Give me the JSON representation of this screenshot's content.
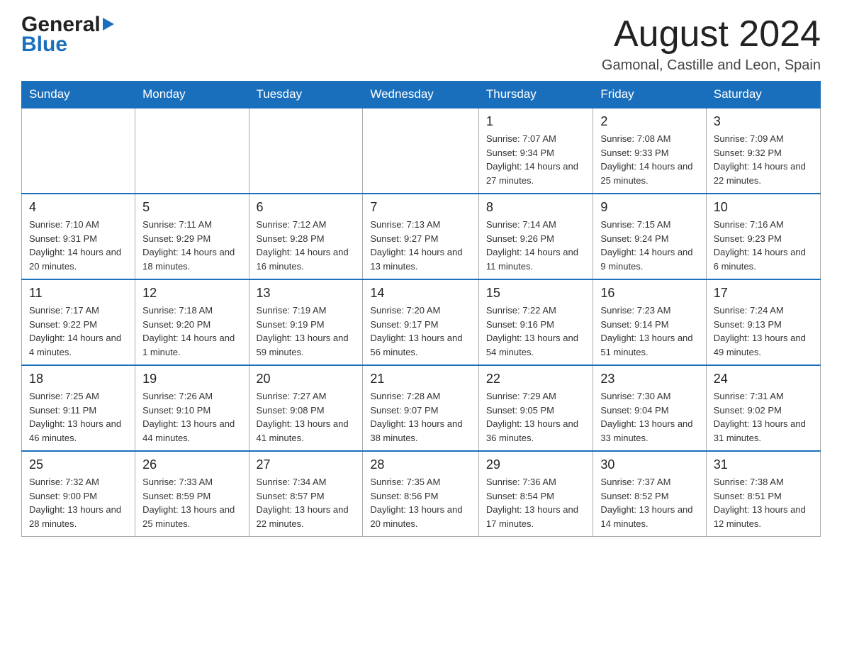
{
  "header": {
    "logo_general": "General",
    "logo_blue": "Blue",
    "month_title": "August 2024",
    "subtitle": "Gamonal, Castille and Leon, Spain"
  },
  "calendar": {
    "days_of_week": [
      "Sunday",
      "Monday",
      "Tuesday",
      "Wednesday",
      "Thursday",
      "Friday",
      "Saturday"
    ],
    "weeks": [
      [
        {
          "day": "",
          "info": ""
        },
        {
          "day": "",
          "info": ""
        },
        {
          "day": "",
          "info": ""
        },
        {
          "day": "",
          "info": ""
        },
        {
          "day": "1",
          "info": "Sunrise: 7:07 AM\nSunset: 9:34 PM\nDaylight: 14 hours and 27 minutes."
        },
        {
          "day": "2",
          "info": "Sunrise: 7:08 AM\nSunset: 9:33 PM\nDaylight: 14 hours and 25 minutes."
        },
        {
          "day": "3",
          "info": "Sunrise: 7:09 AM\nSunset: 9:32 PM\nDaylight: 14 hours and 22 minutes."
        }
      ],
      [
        {
          "day": "4",
          "info": "Sunrise: 7:10 AM\nSunset: 9:31 PM\nDaylight: 14 hours and 20 minutes."
        },
        {
          "day": "5",
          "info": "Sunrise: 7:11 AM\nSunset: 9:29 PM\nDaylight: 14 hours and 18 minutes."
        },
        {
          "day": "6",
          "info": "Sunrise: 7:12 AM\nSunset: 9:28 PM\nDaylight: 14 hours and 16 minutes."
        },
        {
          "day": "7",
          "info": "Sunrise: 7:13 AM\nSunset: 9:27 PM\nDaylight: 14 hours and 13 minutes."
        },
        {
          "day": "8",
          "info": "Sunrise: 7:14 AM\nSunset: 9:26 PM\nDaylight: 14 hours and 11 minutes."
        },
        {
          "day": "9",
          "info": "Sunrise: 7:15 AM\nSunset: 9:24 PM\nDaylight: 14 hours and 9 minutes."
        },
        {
          "day": "10",
          "info": "Sunrise: 7:16 AM\nSunset: 9:23 PM\nDaylight: 14 hours and 6 minutes."
        }
      ],
      [
        {
          "day": "11",
          "info": "Sunrise: 7:17 AM\nSunset: 9:22 PM\nDaylight: 14 hours and 4 minutes."
        },
        {
          "day": "12",
          "info": "Sunrise: 7:18 AM\nSunset: 9:20 PM\nDaylight: 14 hours and 1 minute."
        },
        {
          "day": "13",
          "info": "Sunrise: 7:19 AM\nSunset: 9:19 PM\nDaylight: 13 hours and 59 minutes."
        },
        {
          "day": "14",
          "info": "Sunrise: 7:20 AM\nSunset: 9:17 PM\nDaylight: 13 hours and 56 minutes."
        },
        {
          "day": "15",
          "info": "Sunrise: 7:22 AM\nSunset: 9:16 PM\nDaylight: 13 hours and 54 minutes."
        },
        {
          "day": "16",
          "info": "Sunrise: 7:23 AM\nSunset: 9:14 PM\nDaylight: 13 hours and 51 minutes."
        },
        {
          "day": "17",
          "info": "Sunrise: 7:24 AM\nSunset: 9:13 PM\nDaylight: 13 hours and 49 minutes."
        }
      ],
      [
        {
          "day": "18",
          "info": "Sunrise: 7:25 AM\nSunset: 9:11 PM\nDaylight: 13 hours and 46 minutes."
        },
        {
          "day": "19",
          "info": "Sunrise: 7:26 AM\nSunset: 9:10 PM\nDaylight: 13 hours and 44 minutes."
        },
        {
          "day": "20",
          "info": "Sunrise: 7:27 AM\nSunset: 9:08 PM\nDaylight: 13 hours and 41 minutes."
        },
        {
          "day": "21",
          "info": "Sunrise: 7:28 AM\nSunset: 9:07 PM\nDaylight: 13 hours and 38 minutes."
        },
        {
          "day": "22",
          "info": "Sunrise: 7:29 AM\nSunset: 9:05 PM\nDaylight: 13 hours and 36 minutes."
        },
        {
          "day": "23",
          "info": "Sunrise: 7:30 AM\nSunset: 9:04 PM\nDaylight: 13 hours and 33 minutes."
        },
        {
          "day": "24",
          "info": "Sunrise: 7:31 AM\nSunset: 9:02 PM\nDaylight: 13 hours and 31 minutes."
        }
      ],
      [
        {
          "day": "25",
          "info": "Sunrise: 7:32 AM\nSunset: 9:00 PM\nDaylight: 13 hours and 28 minutes."
        },
        {
          "day": "26",
          "info": "Sunrise: 7:33 AM\nSunset: 8:59 PM\nDaylight: 13 hours and 25 minutes."
        },
        {
          "day": "27",
          "info": "Sunrise: 7:34 AM\nSunset: 8:57 PM\nDaylight: 13 hours and 22 minutes."
        },
        {
          "day": "28",
          "info": "Sunrise: 7:35 AM\nSunset: 8:56 PM\nDaylight: 13 hours and 20 minutes."
        },
        {
          "day": "29",
          "info": "Sunrise: 7:36 AM\nSunset: 8:54 PM\nDaylight: 13 hours and 17 minutes."
        },
        {
          "day": "30",
          "info": "Sunrise: 7:37 AM\nSunset: 8:52 PM\nDaylight: 13 hours and 14 minutes."
        },
        {
          "day": "31",
          "info": "Sunrise: 7:38 AM\nSunset: 8:51 PM\nDaylight: 13 hours and 12 minutes."
        }
      ]
    ]
  }
}
